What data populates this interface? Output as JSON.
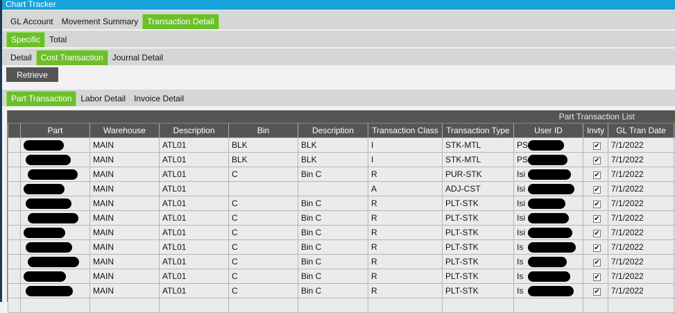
{
  "window": {
    "title": "Chart Tracker"
  },
  "tabs_main": [
    {
      "label": "GL Account"
    },
    {
      "label": "Movement Summary"
    },
    {
      "label": "Transaction Detail",
      "active": true
    }
  ],
  "tabs_sub": [
    {
      "label": "Specific",
      "active": true
    },
    {
      "label": "Total"
    }
  ],
  "tabs_detail": [
    {
      "label": "Detail"
    },
    {
      "label": "Cost Transaction",
      "active": true
    },
    {
      "label": "Journal Detail"
    }
  ],
  "retrieve_label": "Retrieve",
  "tabs_part": [
    {
      "label": "Part Transaction",
      "active": true
    },
    {
      "label": "Labor Detail"
    },
    {
      "label": "Invoice Detail"
    }
  ],
  "grid": {
    "title": "Part Transaction List",
    "columns": [
      "Part",
      "Warehouse",
      "Description",
      "Bin",
      "Description",
      "Transaction Class",
      "Transaction Type",
      "User ID",
      "Invty",
      "GL Tran Date"
    ],
    "rows": [
      [
        "",
        "MAIN",
        "ATL01",
        "BLK",
        "BLK",
        "I",
        "STK-MTL",
        "PS",
        true,
        "7/1/2022"
      ],
      [
        "",
        "MAIN",
        "ATL01",
        "BLK",
        "BLK",
        "I",
        "STK-MTL",
        "PS",
        true,
        "7/1/2022"
      ],
      [
        "",
        "MAIN",
        "ATL01",
        "C",
        "Bin C",
        "R",
        "PUR-STK",
        "Isi",
        true,
        "7/1/2022"
      ],
      [
        "",
        "MAIN",
        "ATL01",
        "",
        "",
        "A",
        "ADJ-CST",
        "Isi",
        true,
        "7/1/2022"
      ],
      [
        "",
        "MAIN",
        "ATL01",
        "C",
        "Bin C",
        "R",
        "PLT-STK",
        "Isi",
        true,
        "7/1/2022"
      ],
      [
        "",
        "MAIN",
        "ATL01",
        "C",
        "Bin C",
        "R",
        "PLT-STK",
        "Isi",
        true,
        "7/1/2022"
      ],
      [
        "",
        "MAIN",
        "ATL01",
        "C",
        "Bin C",
        "R",
        "PLT-STK",
        "Isi",
        true,
        "7/1/2022"
      ],
      [
        "",
        "MAIN",
        "ATL01",
        "C",
        "Bin C",
        "R",
        "PLT-STK",
        "Is",
        true,
        "7/1/2022"
      ],
      [
        "",
        "MAIN",
        "ATL01",
        "C",
        "Bin C",
        "R",
        "PLT-STK",
        "Is",
        true,
        "7/1/2022"
      ],
      [
        "",
        "MAIN",
        "ATL01",
        "C",
        "Bin C",
        "R",
        "PLT-STK",
        "Is",
        true,
        "7/1/2022"
      ],
      [
        "",
        "MAIN",
        "ATL01",
        "C",
        "Bin C",
        "R",
        "PLT-STK",
        "Is",
        true,
        "7/1/2022"
      ]
    ]
  }
}
